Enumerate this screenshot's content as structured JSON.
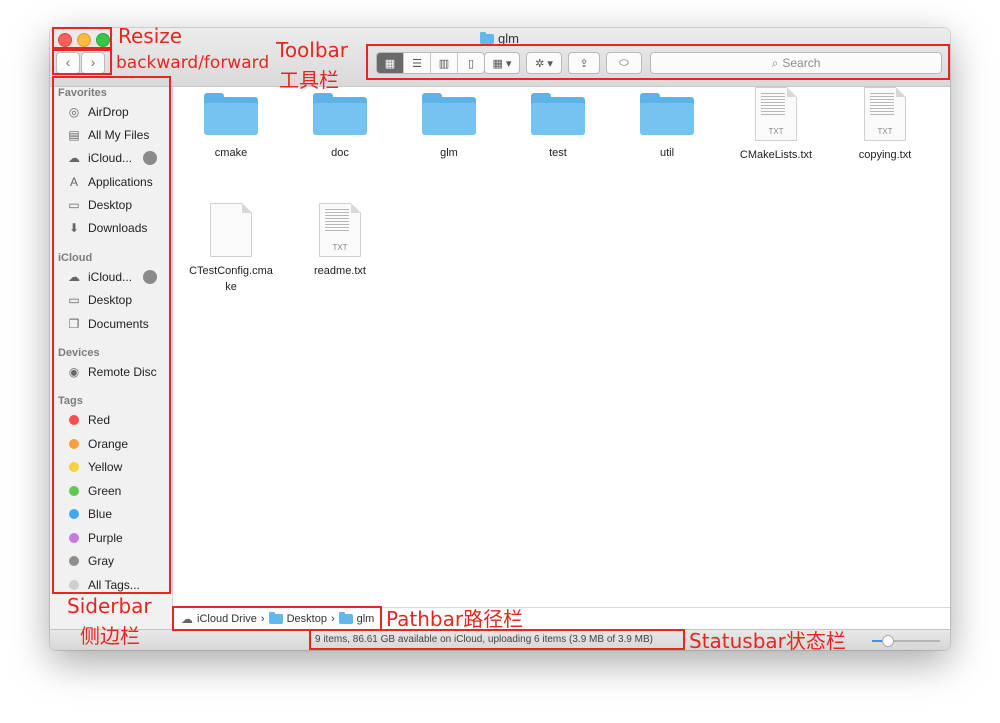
{
  "window": {
    "title": "glm"
  },
  "toolbar": {
    "back": "‹",
    "forward": "›",
    "view_modes": [
      "icon-view",
      "list-view",
      "column-view",
      "cover-flow-view"
    ],
    "search_placeholder": "Search"
  },
  "sidebar": {
    "favorites_header": "Favorites",
    "favorites": [
      {
        "label": "AirDrop",
        "icon": "airdrop-icon"
      },
      {
        "label": "All My Files",
        "icon": "all-files-icon"
      },
      {
        "label": "iCloud...",
        "icon": "cloud-icon"
      },
      {
        "label": "Applications",
        "icon": "applications-icon"
      },
      {
        "label": "Desktop",
        "icon": "desktop-icon"
      },
      {
        "label": "Downloads",
        "icon": "downloads-icon"
      }
    ],
    "icloud_header": "iCloud",
    "icloud": [
      {
        "label": "iCloud...",
        "icon": "cloud-icon"
      },
      {
        "label": "Desktop",
        "icon": "desktop-icon"
      },
      {
        "label": "Documents",
        "icon": "documents-icon"
      }
    ],
    "devices_header": "Devices",
    "devices": [
      {
        "label": "Remote Disc",
        "icon": "disc-icon"
      }
    ],
    "tags_header": "Tags",
    "tags": [
      {
        "label": "Red",
        "color": "#fc4e4e"
      },
      {
        "label": "Orange",
        "color": "#f9a03f"
      },
      {
        "label": "Yellow",
        "color": "#f7d23b"
      },
      {
        "label": "Green",
        "color": "#62c554"
      },
      {
        "label": "Blue",
        "color": "#3fa9f5"
      },
      {
        "label": "Purple",
        "color": "#c57ce0"
      },
      {
        "label": "Gray",
        "color": "#8e8e8e"
      },
      {
        "label": "All Tags...",
        "color": "#cfcfcf"
      }
    ]
  },
  "files": [
    {
      "name": "cmake",
      "kind": "folder"
    },
    {
      "name": "doc",
      "kind": "folder"
    },
    {
      "name": "glm",
      "kind": "folder"
    },
    {
      "name": "test",
      "kind": "folder"
    },
    {
      "name": "util",
      "kind": "folder"
    },
    {
      "name": "CMakeLists.txt",
      "kind": "txt",
      "ext": "TXT"
    },
    {
      "name": "copying.txt",
      "kind": "txt",
      "ext": "TXT"
    },
    {
      "name": "CTestConfig.cma\nke",
      "kind": "blank"
    },
    {
      "name": "readme.txt",
      "kind": "txt",
      "ext": "TXT"
    }
  ],
  "pathbar": {
    "items": [
      "iCloud Drive",
      "Desktop",
      "glm"
    ],
    "separator": "›"
  },
  "statusbar": {
    "text": "9 items, 86.61 GB available on iCloud, uploading 6 items (3.9 MB of 3.9 MB)"
  },
  "annotations": {
    "resize": "Resize",
    "backward_forward": "backward/forward",
    "toolbar": "Toolbar",
    "toolbar_cn": "工具栏",
    "siderbar": "Siderbar",
    "siderbar_cn": "侧边栏",
    "pathbar": "Pathbar路径栏",
    "statusbar": "Statusbar状态栏",
    "color": "#e8261f"
  }
}
